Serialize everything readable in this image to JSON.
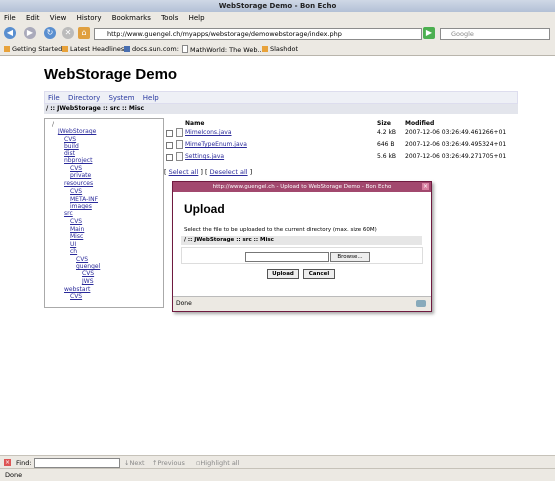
{
  "browser": {
    "title": "WebStorage Demo - Bon Echo",
    "menu": [
      "File",
      "Edit",
      "View",
      "History",
      "Bookmarks",
      "Tools",
      "Help"
    ],
    "url": "http://www.guengel.ch/myapps/webstorage/demowebstorage/index.php",
    "search_placeholder": "Google",
    "bookmarks": [
      "Getting Started",
      "Latest Headlines",
      "docs.sun.com:",
      "MathWorld: The Web...",
      "Slashdot"
    ],
    "status": "Done",
    "find": {
      "label": "Find:",
      "next": "Next",
      "previous": "Previous",
      "highlight": "Highlight all"
    }
  },
  "page": {
    "title": "WebStorage Demo",
    "menu": [
      "File",
      "Directory",
      "System",
      "Help"
    ],
    "breadcrumb": "/ :: JWebStorage :: src :: Misc",
    "tree": [
      "/",
      "JWebStorage",
      "CVS",
      "build",
      "dist",
      "nbproject",
      "CVS",
      "private",
      "resources",
      "CVS",
      "META-INF",
      "images",
      "src",
      "CVS",
      "Main",
      "Misc",
      "UI",
      "ch",
      "CVS",
      "guengel",
      "CVS",
      "JWS",
      "webstart",
      "CVS"
    ],
    "columns": {
      "name": "Name",
      "size": "Size",
      "modified": "Modified"
    },
    "files": [
      {
        "name": "MimeIcons.java",
        "size": "4.2 kB",
        "modified": "2007-12-06 03:26:49.461266+01"
      },
      {
        "name": "MimeTypeEnum.java",
        "size": "646 B",
        "modified": "2007-12-06 03:26:49.495324+01"
      },
      {
        "name": "Settings.java",
        "size": "5.6 kB",
        "modified": "2007-12-06 03:26:49.271705+01"
      }
    ],
    "select_all": "Select all",
    "deselect_all": "Deselect all"
  },
  "dialog": {
    "title": "http://www.guengel.ch - Upload to WebStorage Demo - Bon Echo",
    "heading": "Upload",
    "text": "Select the file to be uploaded to the current directory (max. size 60M)",
    "breadcrumb": "/ :: JWebStorage :: src :: Misc",
    "browse": "Browse...",
    "upload": "Upload",
    "cancel": "Cancel",
    "status": "Done"
  }
}
